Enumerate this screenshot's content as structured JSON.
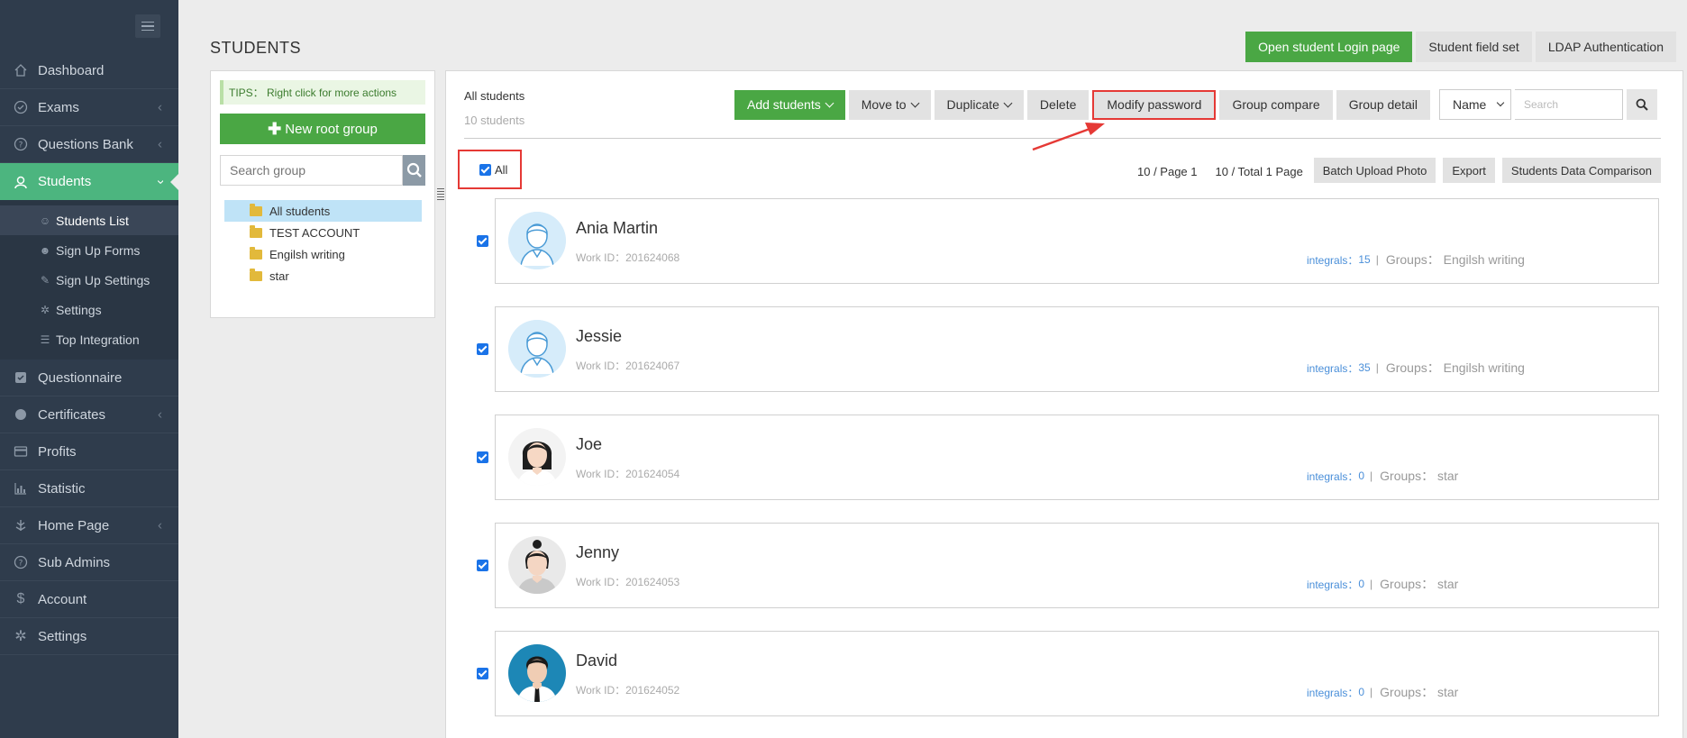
{
  "sidebar": {
    "items": [
      {
        "label": "Dashboard",
        "icon": "home-icon",
        "chevron": false
      },
      {
        "label": "Exams",
        "icon": "check-circle-icon",
        "chevron": true
      },
      {
        "label": "Questions Bank",
        "icon": "question-circle-icon",
        "chevron": true
      },
      {
        "label": "Students",
        "icon": "students-icon",
        "chevron": true,
        "active": true
      },
      {
        "label": "Questionnaire",
        "icon": "checkbox-icon",
        "chevron": false
      },
      {
        "label": "Certificates",
        "icon": "certificate-icon",
        "chevron": true
      },
      {
        "label": "Profits",
        "icon": "credit-card-icon",
        "chevron": false
      },
      {
        "label": "Statistic",
        "icon": "bar-chart-icon",
        "chevron": false
      },
      {
        "label": "Home Page",
        "icon": "home-page-icon",
        "chevron": true
      },
      {
        "label": "Sub Admins",
        "icon": "sub-admins-icon",
        "chevron": false
      },
      {
        "label": "Account",
        "icon": "dollar-icon",
        "chevron": false
      },
      {
        "label": "Settings",
        "icon": "gear-icon",
        "chevron": false
      }
    ],
    "subitems": [
      {
        "label": "Students List",
        "icon": "students-list-icon",
        "active": true
      },
      {
        "label": "Sign Up Forms",
        "icon": "sign-up-forms-icon"
      },
      {
        "label": "Sign Up Settings",
        "icon": "wrench-icon"
      },
      {
        "label": "Settings",
        "icon": "gear-icon"
      },
      {
        "label": "Top Integration",
        "icon": "list-icon"
      }
    ]
  },
  "header": {
    "title": "STUDENTS",
    "actions": {
      "login_page": "Open student Login page",
      "field_set": "Student field set",
      "ldap": "LDAP Authentication"
    }
  },
  "groups": {
    "tips": "TIPS： Right click for more actions",
    "new_root": "New root group",
    "search_placeholder": "Search group",
    "tree": [
      "All students",
      "TEST ACCOUNT",
      "Engilsh writing",
      "star"
    ]
  },
  "main": {
    "title": "All students",
    "count": "10 students",
    "toolbar": {
      "add": "Add students",
      "move": "Move to",
      "duplicate": "Duplicate",
      "delete": "Delete",
      "modify_password": "Modify password",
      "group_compare": "Group compare",
      "group_detail": "Group detail",
      "select_value": "Name",
      "search_placeholder": "Search"
    },
    "all_label": "All",
    "paging": {
      "per_page": "10 / Page 1",
      "total": "10 / Total 1 Page"
    },
    "tools": {
      "batch": "Batch Upload Photo",
      "export": "Export",
      "compare": "Students Data Comparison"
    },
    "students": [
      {
        "name": "Ania Martin",
        "work_id": "Work ID：201624068",
        "integrals_label": "integrals：",
        "integrals": "15",
        "groups": "Groups： Engilsh writing",
        "avatar": "default"
      },
      {
        "name": "Jessie",
        "work_id": "Work ID：201624067",
        "integrals_label": "integrals：",
        "integrals": "35",
        "groups": "Groups： Engilsh writing",
        "avatar": "default"
      },
      {
        "name": "Joe",
        "work_id": "Work ID：201624054",
        "integrals_label": "integrals：",
        "integrals": "0",
        "groups": "Groups： star",
        "avatar": "photo-woman"
      },
      {
        "name": "Jenny",
        "work_id": "Work ID：201624053",
        "integrals_label": "integrals：",
        "integrals": "0",
        "groups": "Groups： star",
        "avatar": "photo-woman-2"
      },
      {
        "name": "David",
        "work_id": "Work ID：201624052",
        "integrals_label": "integrals：",
        "integrals": "0",
        "groups": "Groups： star",
        "avatar": "photo-man"
      }
    ]
  },
  "colors": {
    "sidebar": "#2f3c4c",
    "accent": "#4cb57f",
    "green_button": "#4aa744",
    "highlight": "#e53935",
    "link": "#4a8fd9"
  }
}
